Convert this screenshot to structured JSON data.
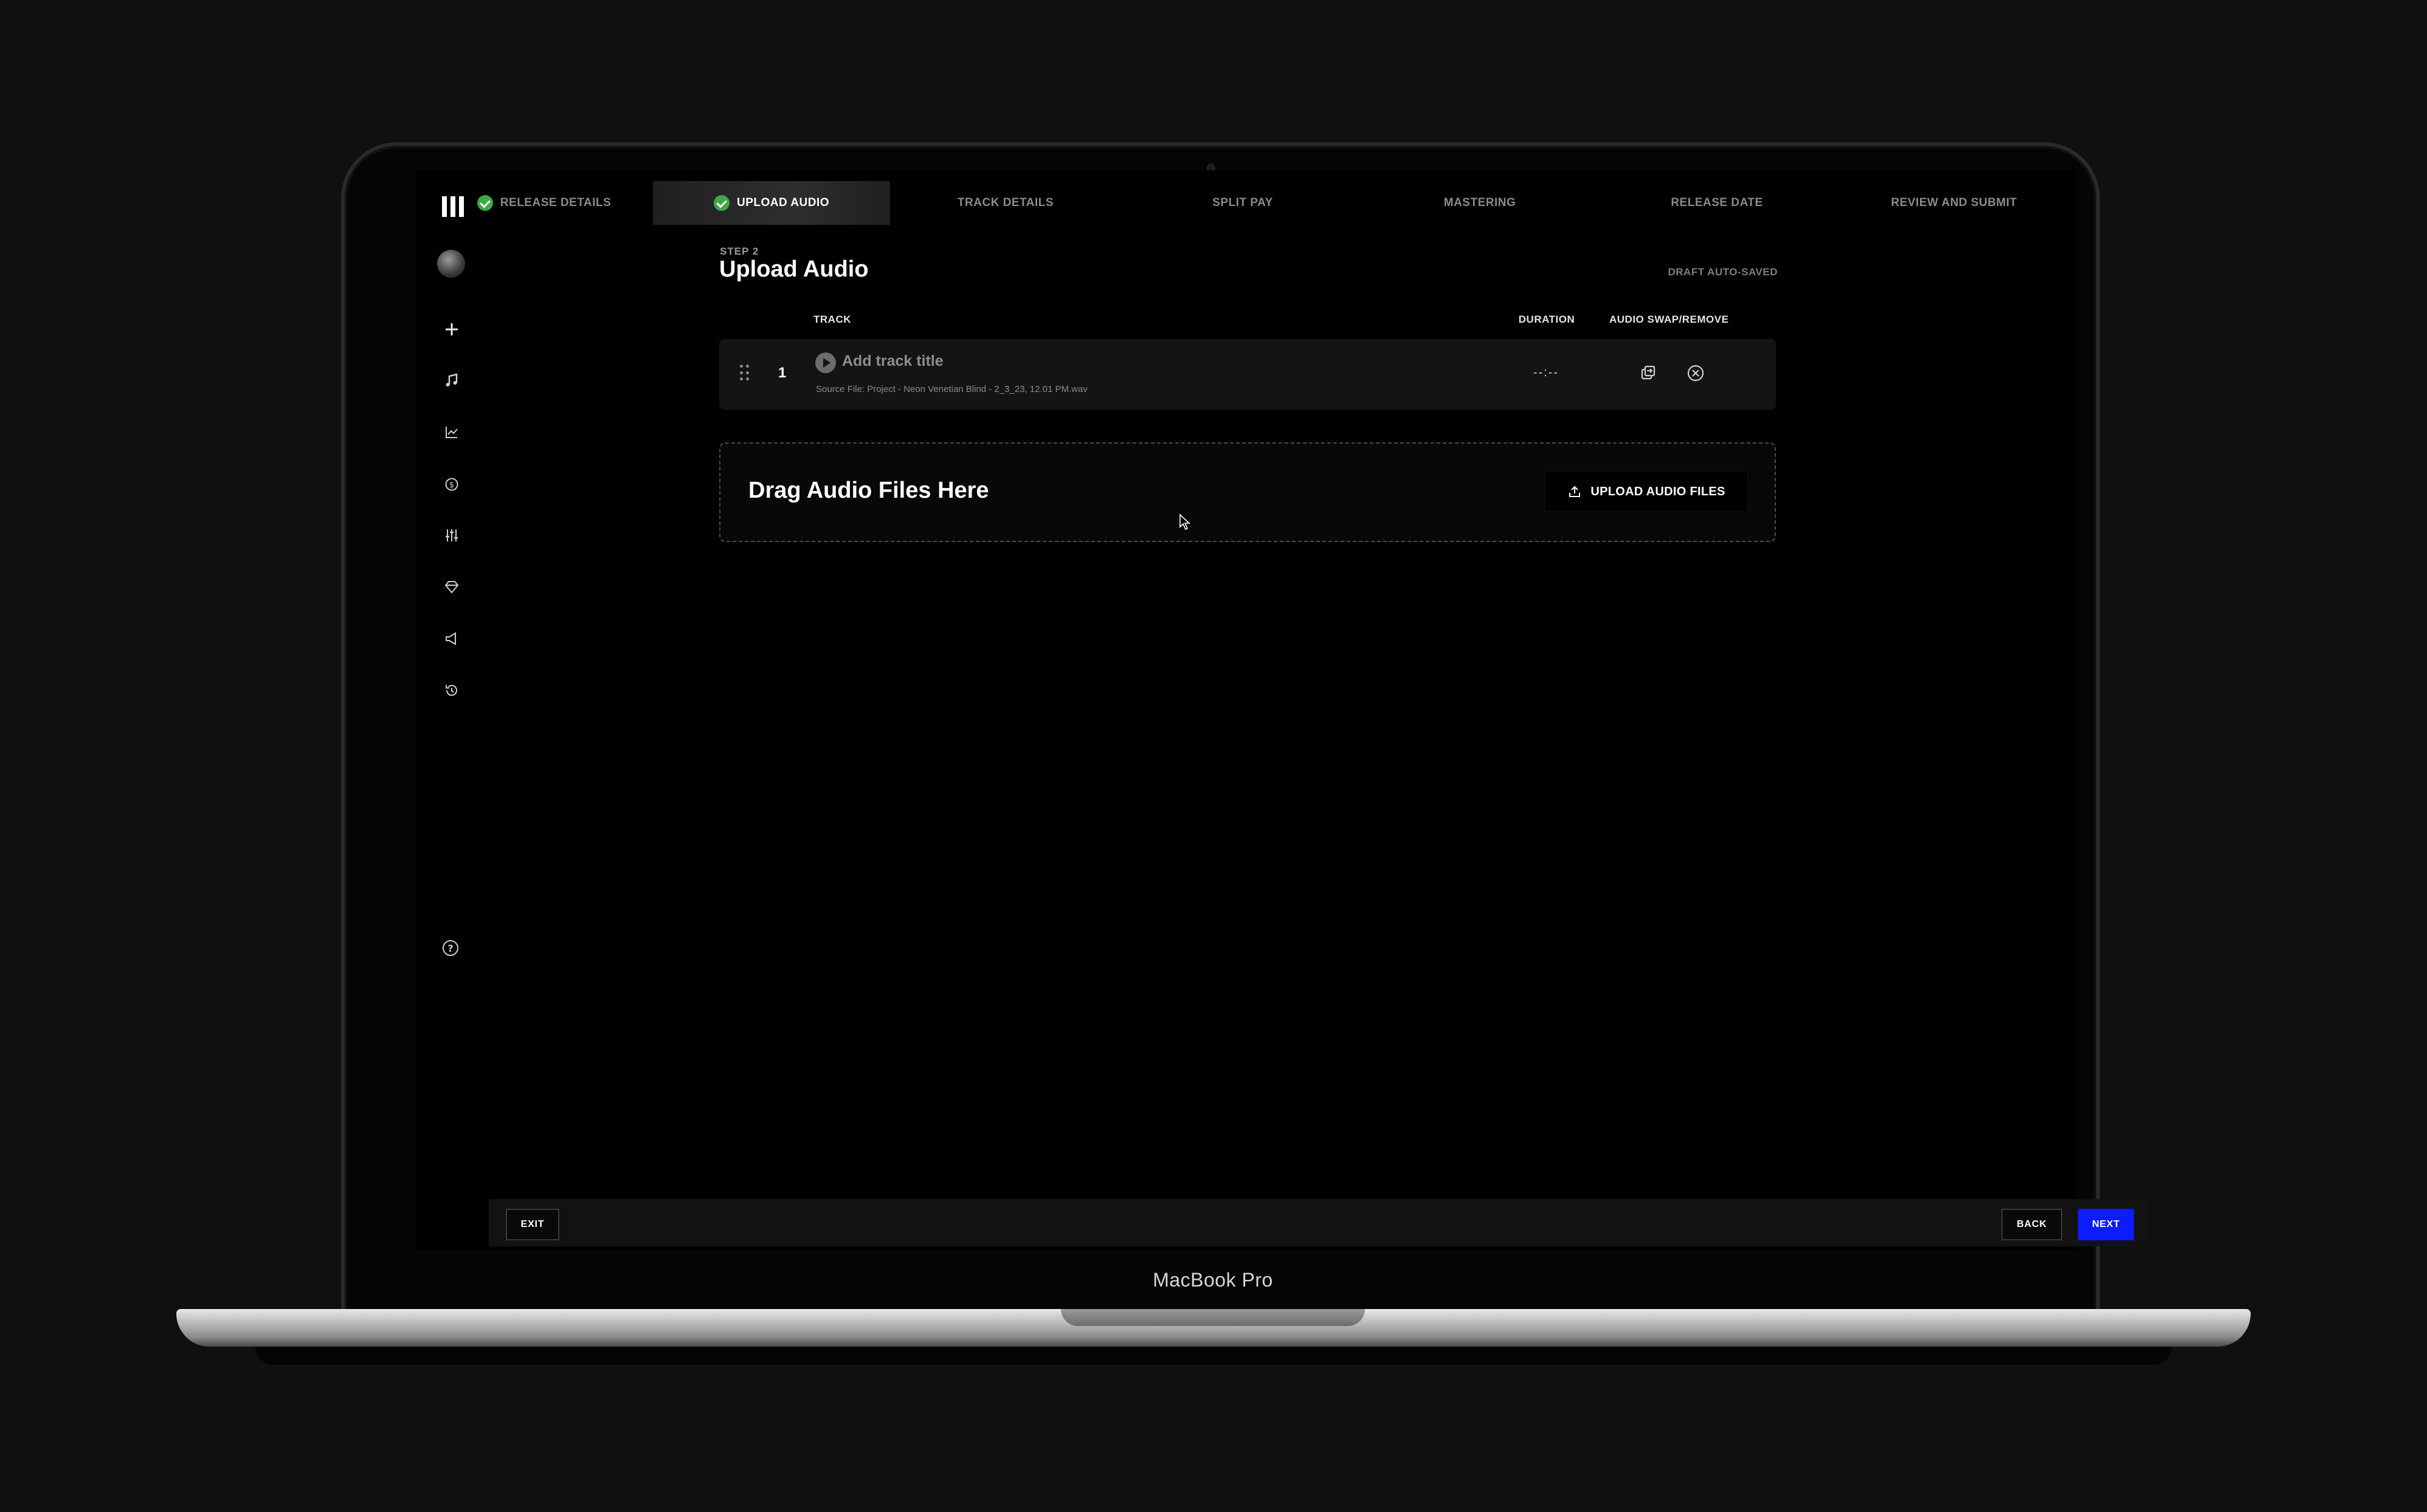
{
  "device": {
    "label": "MacBook Pro"
  },
  "sidebar": {
    "icons": [
      "logo-icon",
      "avatar",
      "plus-icon",
      "music-note-icon",
      "chart-icon",
      "dollar-icon",
      "sliders-icon",
      "diamond-icon",
      "megaphone-icon",
      "history-icon",
      "help-icon"
    ]
  },
  "steps": [
    {
      "label": "RELEASE DETAILS",
      "completed": true,
      "active": false
    },
    {
      "label": "UPLOAD AUDIO",
      "completed": true,
      "active": true
    },
    {
      "label": "TRACK DETAILS",
      "completed": false,
      "active": false
    },
    {
      "label": "SPLIT PAY",
      "completed": false,
      "active": false
    },
    {
      "label": "MASTERING",
      "completed": false,
      "active": false
    },
    {
      "label": "RELEASE DATE",
      "completed": false,
      "active": false
    },
    {
      "label": "REVIEW AND SUBMIT",
      "completed": false,
      "active": false
    }
  ],
  "header": {
    "step_label": "STEP 2",
    "title": "Upload Audio",
    "autosave": "DRAFT AUTO-SAVED"
  },
  "table": {
    "columns": {
      "track": "TRACK",
      "duration": "DURATION",
      "actions": "AUDIO SWAP/REMOVE"
    },
    "rows": [
      {
        "number": "1",
        "title_placeholder": "Add track title",
        "source": "Source File: Project - Neon Venetian Blind - 2_3_23, 12.01 PM.wav",
        "duration": "--:--"
      }
    ]
  },
  "dropzone": {
    "title": "Drag Audio Files Here",
    "button_label": "UPLOAD AUDIO FILES"
  },
  "footer": {
    "exit_label": "EXIT",
    "back_label": "BACK",
    "next_label": "NEXT"
  },
  "colors": {
    "accent": "#0d1cff",
    "success": "#3fa84a",
    "background": "#000000"
  }
}
